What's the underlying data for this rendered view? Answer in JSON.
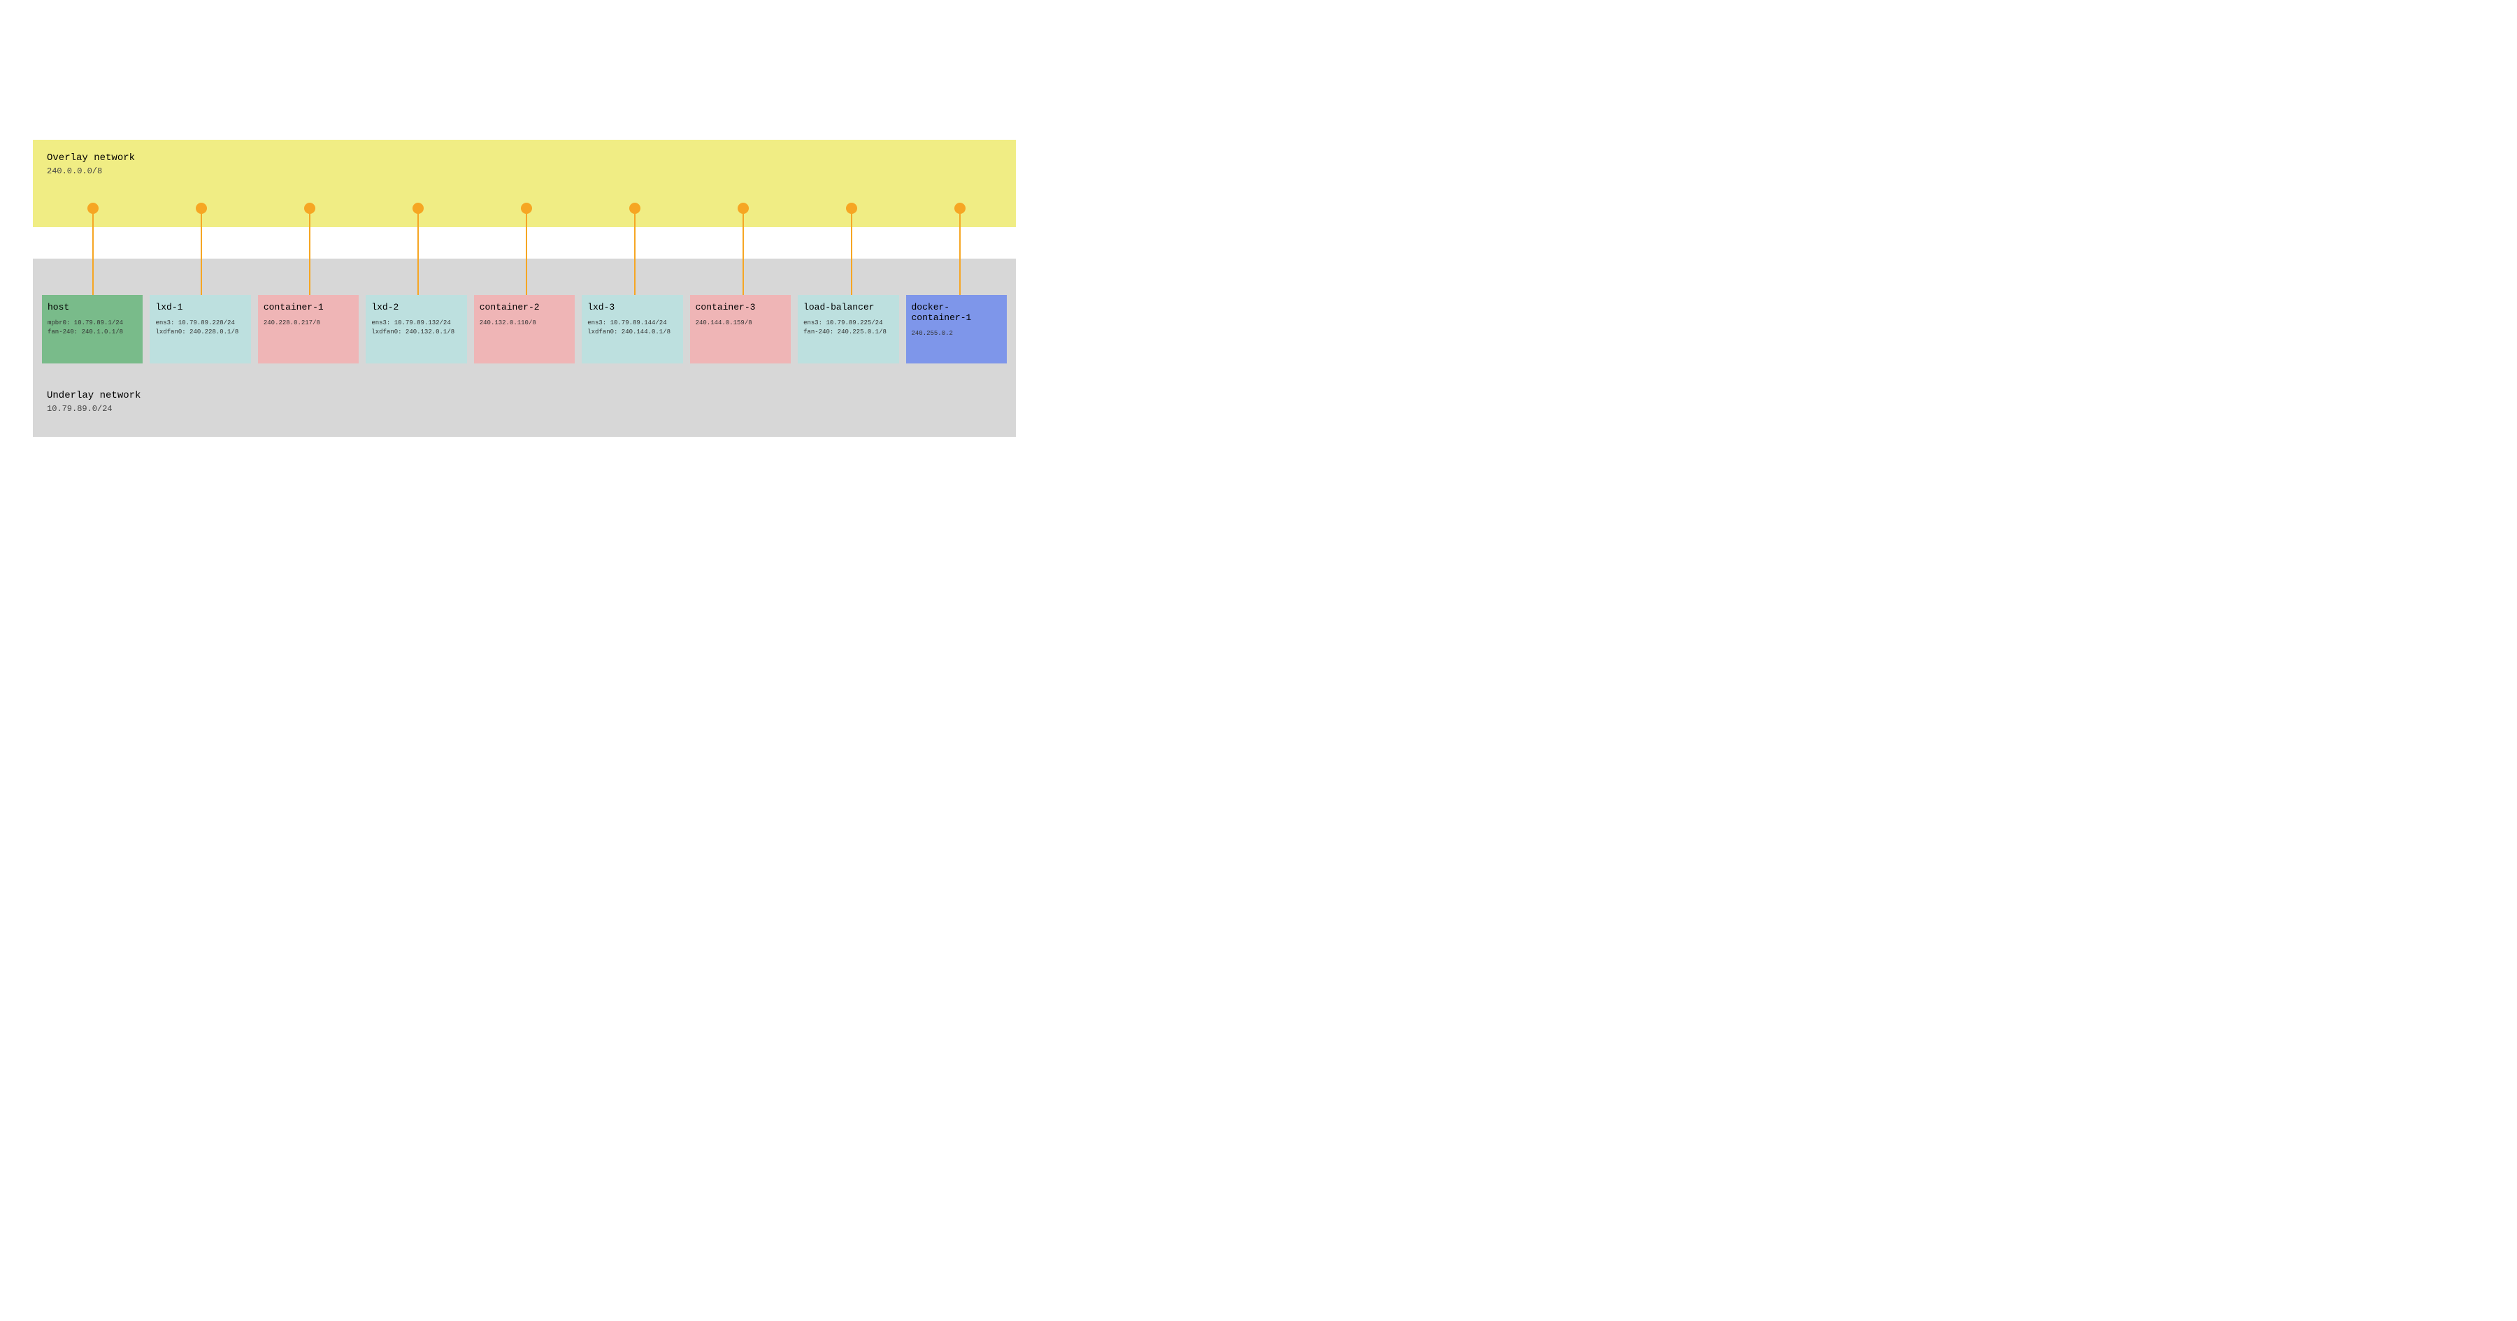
{
  "overlay": {
    "title": "Overlay network",
    "subtitle": "240.0.0.0/8"
  },
  "underlay": {
    "title": "Underlay network",
    "subtitle": "10.79.89.0/24"
  },
  "nodes": [
    {
      "name": "host",
      "color": "c-green",
      "lines": [
        "mpbr0: 10.79.89.1/24",
        "fan-240: 240.1.0.1/8"
      ]
    },
    {
      "name": "lxd-1",
      "color": "c-teal",
      "lines": [
        "ens3: 10.79.89.228/24",
        "lxdfan0: 240.228.0.1/8"
      ]
    },
    {
      "name": "container-1",
      "color": "c-pink",
      "lines": [
        "240.228.0.217/8"
      ]
    },
    {
      "name": "lxd-2",
      "color": "c-teal",
      "lines": [
        "ens3: 10.79.89.132/24",
        "lxdfan0: 240.132.0.1/8"
      ]
    },
    {
      "name": "container-2",
      "color": "c-pink",
      "lines": [
        "240.132.0.110/8"
      ]
    },
    {
      "name": "lxd-3",
      "color": "c-teal",
      "lines": [
        "ens3: 10.79.89.144/24",
        "lxdfan0: 240.144.0.1/8"
      ]
    },
    {
      "name": "container-3",
      "color": "c-pink",
      "lines": [
        "240.144.0.159/8"
      ]
    },
    {
      "name": "load-balancer",
      "color": "c-teal",
      "lines": [
        "ens3: 10.79.89.225/24",
        "fan-240: 240.225.0.1/8"
      ]
    },
    {
      "name": "docker-container-1",
      "color": "c-blue",
      "lines": [
        "240.255.0.2"
      ]
    }
  ]
}
